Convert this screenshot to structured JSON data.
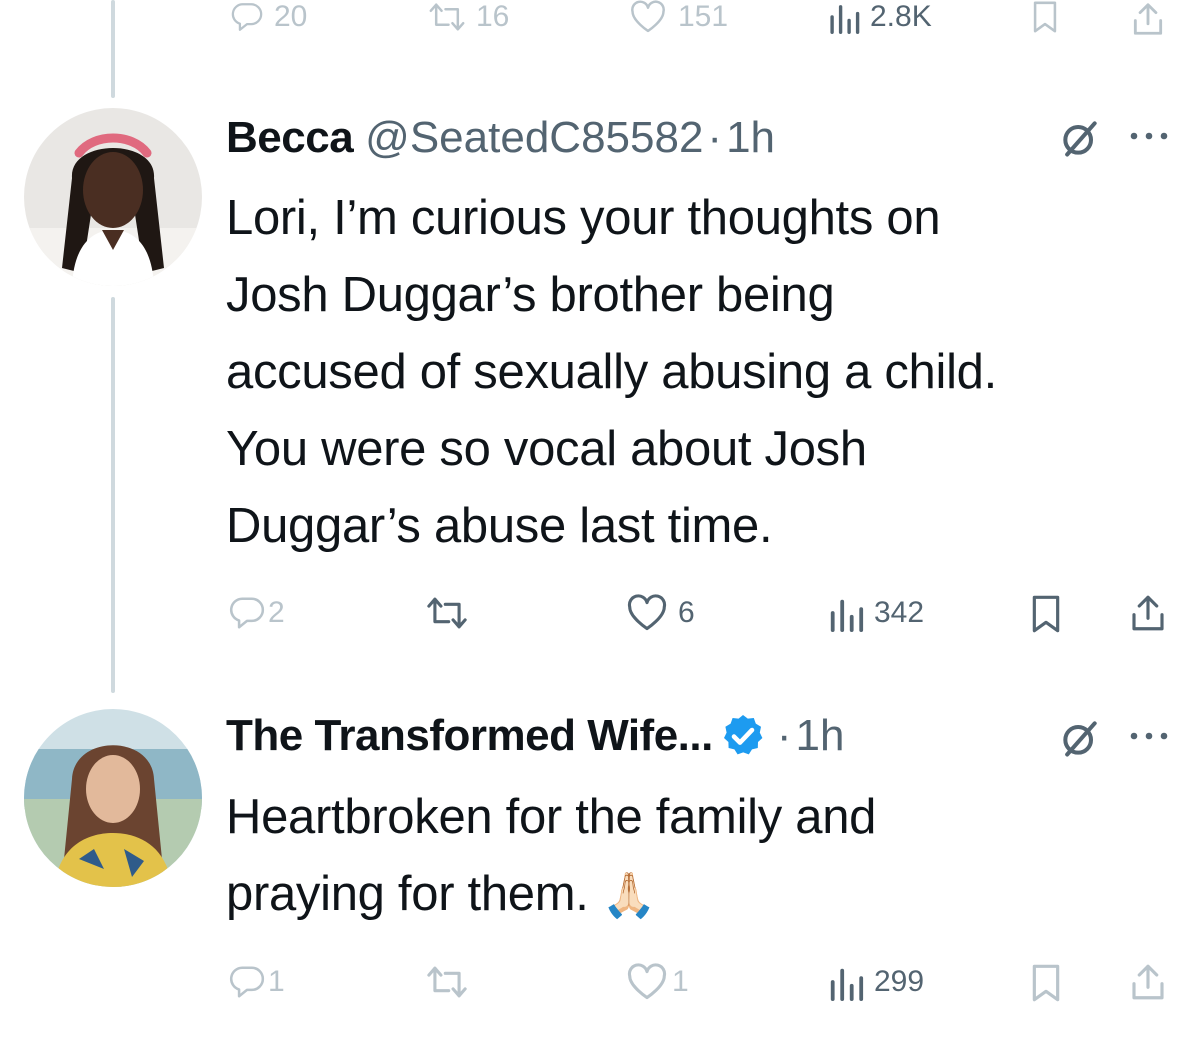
{
  "prev_tweet": {
    "actions": {
      "replies": "20",
      "reposts": "16",
      "likes": "151",
      "views": "2.8K"
    }
  },
  "tweets": [
    {
      "display_name": "Becca",
      "handle": "@SeatedC85582",
      "separator": "·",
      "time": "1h",
      "text_lines": [
        "Lori, I’m curious your thoughts on",
        "Josh Duggar’s brother being",
        "accused of sexually abusing a child.",
        "You were so vocal about Josh",
        "Duggar’s abuse last time."
      ],
      "actions": {
        "replies": "2",
        "likes": "6",
        "views": "342"
      }
    },
    {
      "display_name": "The Transformed Wife...",
      "verified": true,
      "separator": "·",
      "time": "1h",
      "text_lines": [
        "Heartbroken for the family and",
        "praying for them."
      ],
      "emoji": "🙏🏻",
      "actions": {
        "replies": "1",
        "likes": "1",
        "views": "299"
      }
    }
  ],
  "colors": {
    "text": "#0f1419",
    "secondary": "#536471",
    "faded": "#b9c4cb",
    "verified": "#1d9bf0",
    "thread_line": "#cfd9de"
  },
  "icons": [
    "reply-icon",
    "repost-icon",
    "like-icon",
    "views-icon",
    "bookmark-icon",
    "share-icon",
    "grok-icon",
    "more-icon",
    "verified-badge-icon"
  ]
}
